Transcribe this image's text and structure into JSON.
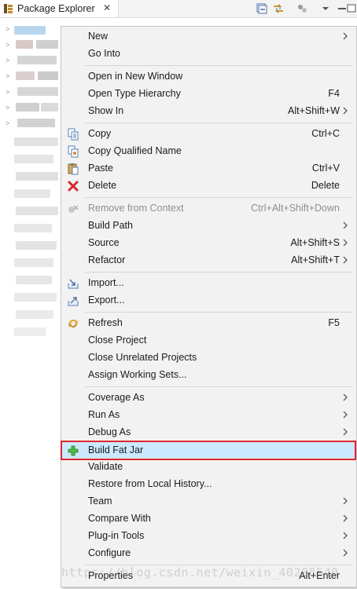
{
  "view": {
    "title": "Package Explorer",
    "close_glyph": "✕"
  },
  "toolbar": {
    "icons": [
      "collapse-all-icon",
      "link-with-editor-icon",
      "focus-icon",
      "view-menu-icon",
      "minimize-icon",
      "maximize-icon"
    ]
  },
  "menu": {
    "items": [
      {
        "label": "New",
        "accel": "",
        "submenu": true
      },
      {
        "label": "Go Into",
        "accel": "",
        "submenu": false
      },
      {
        "label": "Open in New Window",
        "accel": "",
        "submenu": false
      },
      {
        "label": "Open Type Hierarchy",
        "accel": "F4",
        "submenu": false
      },
      {
        "label": "Show In",
        "accel": "Alt+Shift+W",
        "submenu": true
      },
      {
        "label": "Copy",
        "accel": "Ctrl+C",
        "submenu": false,
        "icon": "copy-icon"
      },
      {
        "label": "Copy Qualified Name",
        "accel": "",
        "submenu": false,
        "icon": "copy-qualified-name-icon"
      },
      {
        "label": "Paste",
        "accel": "Ctrl+V",
        "submenu": false,
        "icon": "paste-icon"
      },
      {
        "label": "Delete",
        "accel": "Delete",
        "submenu": false,
        "icon": "delete-icon"
      },
      {
        "label": "Remove from Context",
        "accel": "Ctrl+Alt+Shift+Down",
        "submenu": false,
        "icon": "remove-from-context-icon",
        "disabled": true
      },
      {
        "label": "Build Path",
        "accel": "",
        "submenu": true
      },
      {
        "label": "Source",
        "accel": "Alt+Shift+S",
        "submenu": true
      },
      {
        "label": "Refactor",
        "accel": "Alt+Shift+T",
        "submenu": true
      },
      {
        "label": "Import...",
        "accel": "",
        "submenu": false,
        "icon": "import-icon"
      },
      {
        "label": "Export...",
        "accel": "",
        "submenu": false,
        "icon": "export-icon"
      },
      {
        "label": "Refresh",
        "accel": "F5",
        "submenu": false,
        "icon": "refresh-icon"
      },
      {
        "label": "Close Project",
        "accel": "",
        "submenu": false
      },
      {
        "label": "Close Unrelated Projects",
        "accel": "",
        "submenu": false
      },
      {
        "label": "Assign Working Sets...",
        "accel": "",
        "submenu": false
      },
      {
        "label": "Coverage As",
        "accel": "",
        "submenu": true
      },
      {
        "label": "Run As",
        "accel": "",
        "submenu": true
      },
      {
        "label": "Debug As",
        "accel": "",
        "submenu": true
      },
      {
        "label": "Build Fat Jar",
        "accel": "",
        "submenu": false,
        "icon": "build-fat-jar-icon",
        "highlighted": true
      },
      {
        "label": "Validate",
        "accel": "",
        "submenu": false
      },
      {
        "label": "Restore from Local History...",
        "accel": "",
        "submenu": false
      },
      {
        "label": "Team",
        "accel": "",
        "submenu": true
      },
      {
        "label": "Compare With",
        "accel": "",
        "submenu": true
      },
      {
        "label": "Plug-in Tools",
        "accel": "",
        "submenu": true
      },
      {
        "label": "Configure",
        "accel": "",
        "submenu": true
      },
      {
        "label": "Properties",
        "accel": "Alt+Enter",
        "submenu": false
      }
    ]
  },
  "watermark": "https://blog.csdn.net/weixin_40208540",
  "colors": {
    "menu_bg": "#f2f2f2",
    "highlight_bg": "#cce8ff",
    "highlight_border": "#e0262b",
    "disabled_text": "#8f8f8f"
  }
}
